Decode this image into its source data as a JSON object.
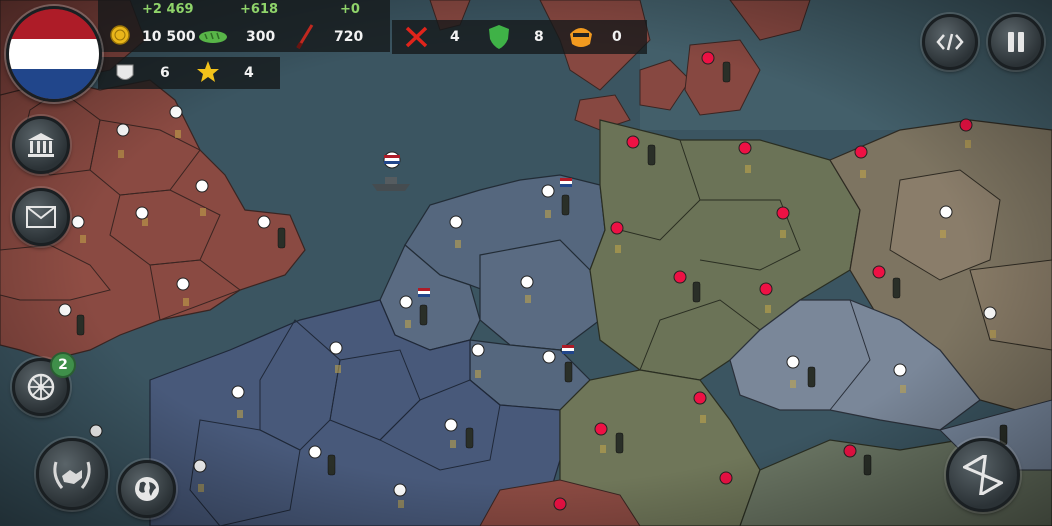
{
  "player": {
    "nation": "Netherlands",
    "flag_colors": [
      "#ae1c28",
      "#ffffff",
      "#21468b"
    ]
  },
  "resources": {
    "gold": {
      "value": "10 500",
      "delta": "+2 469",
      "icon": "coin-icon"
    },
    "food": {
      "value": "300",
      "delta": "+618",
      "icon": "bread-icon"
    },
    "industry": {
      "value": "720",
      "delta": "+0",
      "icon": "bayonet-icon"
    }
  },
  "stats": {
    "attack": {
      "value": "4",
      "icon": "crossed-swords-icon"
    },
    "defense": {
      "value": "8",
      "icon": "shield-icon"
    },
    "espionage": {
      "value": "0",
      "icon": "masked-spy-icon"
    },
    "armies": {
      "value": "6",
      "icon": "helmet-badge-icon"
    },
    "generals": {
      "value": "4",
      "icon": "star-icon"
    }
  },
  "buttons": {
    "left": [
      {
        "name": "government-button",
        "icon": "bank-building-icon"
      },
      {
        "name": "messages-button",
        "icon": "envelope-icon"
      },
      {
        "name": "wheel-button",
        "icon": "wagon-wheel-icon",
        "badge": "2"
      },
      {
        "name": "diplomacy-button",
        "icon": "handshake-laurel-icon"
      },
      {
        "name": "world-button",
        "icon": "globe-icon"
      }
    ],
    "right": [
      {
        "name": "code-button",
        "icon": "code-brackets-icon"
      },
      {
        "name": "pause-button",
        "icon": "pause-icon"
      },
      {
        "name": "end-turn-button",
        "icon": "hourglass-icon"
      }
    ]
  },
  "colors": {
    "sea": "#3d5560",
    "britain": "#8a4a42",
    "france": "#4a5a7a",
    "benelux": "#55667d",
    "germany": "#6b7356",
    "czech": "#7a8799",
    "poland": "#8a7a66",
    "denmark": "#8a4a42"
  }
}
